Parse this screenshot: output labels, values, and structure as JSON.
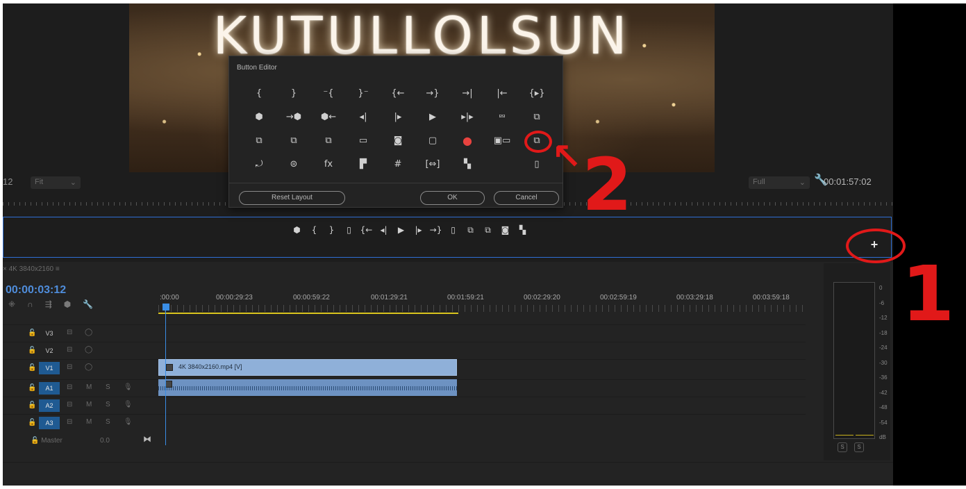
{
  "monitor": {
    "preview_title": "KUTULLOLSUN",
    "zoom_prefix": "12",
    "fit_select": "Fit",
    "quality_select": "Full",
    "timecode": "00:01:57:02"
  },
  "transport": {
    "buttons": [
      "⬢",
      "{",
      "}",
      "▯",
      "{←",
      "◂|",
      "▶",
      "|▸",
      "→}",
      "▯",
      "⧉",
      "⧉",
      "◙",
      "▚"
    ],
    "add_button": "+"
  },
  "dialog": {
    "title": "Button Editor",
    "icons": [
      "{",
      "}",
      "⁻{",
      "}⁻",
      "{←",
      "→}",
      "→|",
      "|←",
      "{▸}",
      "⬢",
      "→⬢",
      "⬢←",
      "◂|",
      "|▸",
      "▶",
      "▸|▸",
      "⮹",
      "⧉",
      "⧉",
      "⧉",
      "⧉",
      "▭",
      "◙",
      "▢",
      "●",
      "▣▭",
      "⧉",
      "⤾",
      "⊜",
      "fx",
      "▛",
      "#",
      "[⇔]",
      "▚",
      "",
      "▯"
    ],
    "reset_label": "Reset Layout",
    "ok_label": "OK",
    "cancel_label": "Cancel"
  },
  "timeline": {
    "sequence_tab": "× 4K 3840x2160 ≡",
    "timecode": "00:00:03:12",
    "ruler_labels": [
      ":00:00",
      "00:00:29:23",
      "00:00:59:22",
      "00:01:29:21",
      "00:01:59:21",
      "00:02:29:20",
      "00:02:59:19",
      "00:03:29:18",
      "00:03:59:18"
    ],
    "tracks": [
      {
        "name": "V3",
        "active": false,
        "type": "video"
      },
      {
        "name": "V2",
        "active": false,
        "type": "video"
      },
      {
        "name": "V1",
        "active": true,
        "type": "video"
      },
      {
        "name": "A1",
        "active": true,
        "type": "audio"
      },
      {
        "name": "A2",
        "active": true,
        "type": "audio"
      },
      {
        "name": "A3",
        "active": true,
        "type": "audio"
      }
    ],
    "clip_label": "4K 3840x2160.mp4 [V]",
    "master_label": "Master",
    "master_value": "0.0"
  },
  "meter": {
    "db_labels": [
      "0",
      "-6",
      "-12",
      "-18",
      "-24",
      "-30",
      "-36",
      "-42",
      "-48",
      "-54",
      "dB"
    ],
    "solo_labels": [
      "S",
      "S"
    ]
  },
  "annotations": {
    "one": "1",
    "two": "2",
    "arrow": "↖"
  },
  "colors": {
    "accent_blue": "#2f6fd6",
    "annotation_red": "#e11919",
    "record_red": "#e8433f"
  }
}
